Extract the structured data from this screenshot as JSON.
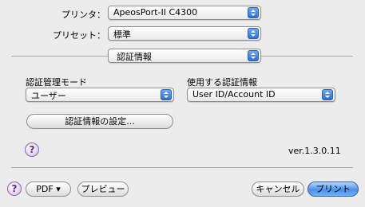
{
  "printer": {
    "label": "プリンタ：",
    "value": "ApeosPort-II C4300"
  },
  "preset": {
    "label": "プリセット：",
    "value": "標準"
  },
  "panel": {
    "value": "認証情報"
  },
  "auth_mode": {
    "label": "認証管理モード",
    "value": "ユーザー"
  },
  "auth_info": {
    "label": "使用する認証情報",
    "value": "User ID/Account ID"
  },
  "settings_button": {
    "label": "認証情報の設定..."
  },
  "help": {
    "symbol": "?"
  },
  "version": "ver.1.3.0.11",
  "footer": {
    "pdf_label": "PDF ▾",
    "preview_label": "プレビュー",
    "cancel_label": "キャンセル",
    "print_label": "プリント"
  }
}
